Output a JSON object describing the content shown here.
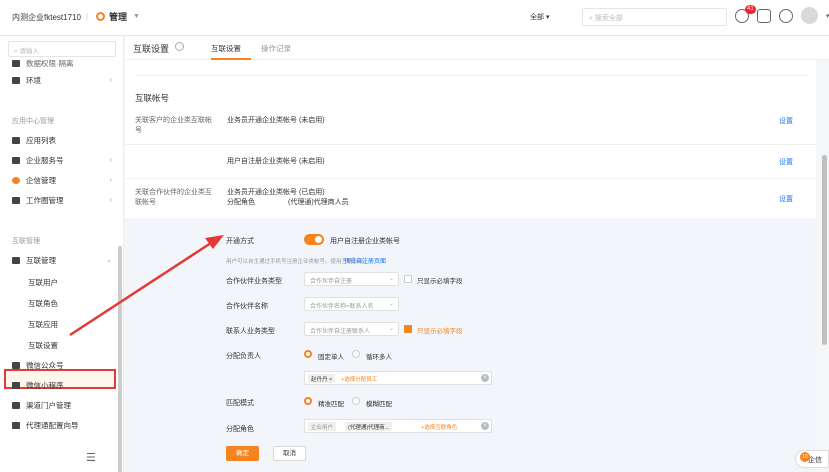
{
  "topbar": {
    "org_name": "内测企业fktest1710",
    "module_name": "管理",
    "scope_label": "全部",
    "search_placeholder": "搜索全部",
    "notification_count": "41"
  },
  "sidebar": {
    "search_placeholder": "请输入",
    "partial_item": "数据权限·隔离",
    "env_label": "环境",
    "group_app_center": "应用中心管理",
    "items_app": [
      {
        "label": "应用列表"
      },
      {
        "label": "企业服务号"
      },
      {
        "label": "企信管理"
      },
      {
        "label": "工作圈管理"
      }
    ],
    "group_interconnect": "互联管理",
    "interconnect_manage": "互联管理",
    "sub_items": [
      {
        "label": "互联用户"
      },
      {
        "label": "互联角色"
      },
      {
        "label": "互联应用"
      },
      {
        "label": "互联设置"
      }
    ],
    "items_bottom": [
      {
        "label": "微信公众号"
      },
      {
        "label": "微信小程序"
      },
      {
        "label": "渠道门户管理"
      },
      {
        "label": "代理通配置向导"
      }
    ]
  },
  "header": {
    "title": "互联设置",
    "tabs": [
      {
        "label": "互联设置"
      },
      {
        "label": "操作记录"
      }
    ]
  },
  "main": {
    "section_title": "互联帐号",
    "row1_label": "关联客户的企业类互联帐号",
    "row1_text": "业务员开通企业类帐号 (未启用)",
    "row2_text": "用户自注册企业类帐号 (未启用)",
    "row3_label": "关联合作伙伴的企业类互联帐号",
    "row3_text": "业务员开通企业类帐号 (已启用)",
    "row3_role_label": "分配角色",
    "row3_role_value": "(代理通)代理商人员",
    "set_link": "设置",
    "form": {
      "open_mode_label": "开通方式",
      "open_mode_value": "用户自注册企业类帐号",
      "hint": "用户可以自主通过手机号注册企业类帐号。使用互联业务。",
      "hint_link": "预览自注册页面",
      "partner_type_label": "合作伙伴业务类型",
      "partner_type_value": "合作伙伴自注册",
      "partner_type_check": "只显示必填字段",
      "partner_name_label": "合作伙伴名称",
      "partner_name_value": "合作伙伴名称=联系人名",
      "contact_type_label": "联系人业务类型",
      "contact_type_value": "合作伙伴自注册联系人",
      "contact_type_check": "只显示必填字段",
      "owner_label": "分配负责人",
      "owner_opt1": "固定单人",
      "owner_opt2": "循环多人",
      "owner_tag": "赵丹丹 ×",
      "owner_add": "+选择分配员工",
      "match_label": "匹配模式",
      "match_opt1": "精准匹配",
      "match_opt2": "模糊匹配",
      "role_label": "分配角色",
      "role_tag1": "企业用户",
      "role_tag2": "(代理通)代理商...",
      "role_add": "+选择互联角色",
      "confirm": "确定",
      "cancel": "取消"
    }
  },
  "float_widget": {
    "badge": "10",
    "label": "企信"
  },
  "colors": {
    "accent": "#f5831f",
    "link": "#1677ff",
    "annotation": "#e53935"
  }
}
